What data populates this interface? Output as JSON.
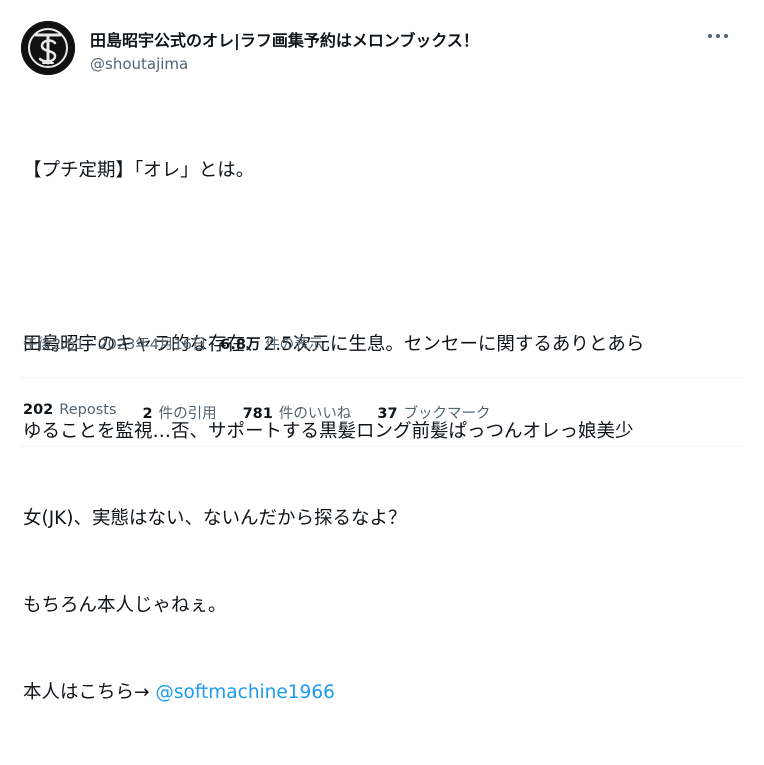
{
  "author": {
    "display_name": "田島昭宇公式のオレ|ラフ画集予約はメロンブックス！",
    "handle": "@shoutajima"
  },
  "tweet": {
    "lines": [
      "【プチ定期】「オレ」とは。",
      "",
      "田島昭宇のキャラ的な存在、2.5次元に生息。センセーに関するありとあら",
      "ゆることを監視…否、サポートする黒髪ロング前髪ぱっつんオレっ娘美少",
      "女(JK)、実態はない、ないんだから探るなよ？",
      "もちろん本人じゃねぇ。"
    ],
    "last_line_prefix": "本人はこちら→ ",
    "mention": "@softmachine1966"
  },
  "meta": {
    "timestamp": "午後2:51 · 2023年4月16日 · ",
    "views_count": "6.8万",
    "views_label": " 件の表示"
  },
  "stats": {
    "reposts_count": "202",
    "reposts_label": "Reposts",
    "quotes_count": "2",
    "quotes_label": "件の引用",
    "likes_count": "781",
    "likes_label": "件のいいね",
    "bookmarks_count": "37",
    "bookmarks_label": "ブックマーク"
  },
  "icons": {
    "more": "more-horizontal-icon",
    "avatar": "avatar-logo"
  }
}
